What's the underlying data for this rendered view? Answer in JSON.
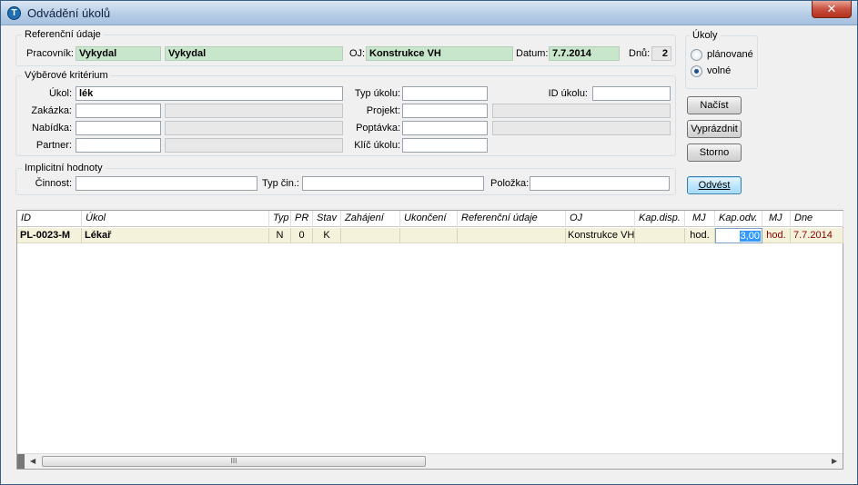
{
  "window": {
    "title": "Odvádění úkolů",
    "close_label": "✕",
    "app_icon_glyph": "T"
  },
  "ref": {
    "legend": "Referenční údaje",
    "pracovnik_label": "Pracovník:",
    "pracovnik_code": "Vykydal",
    "pracovnik_name": "Vykydal",
    "oj_label": "OJ:",
    "oj_value": "Konstrukce VH",
    "datum_label": "Datum:",
    "datum_value": "7.7.2014",
    "dnu_label": "Dnů:",
    "dnu_value": "2"
  },
  "ukoly": {
    "legend": "Úkoly",
    "planovane": "plánované",
    "volne": "volné",
    "selected": "volné"
  },
  "criteria": {
    "legend": "Výběrové kritérium",
    "ukol_label": "Úkol:",
    "ukol_value": "lék",
    "typ_ukolu_label": "Typ úkolu:",
    "id_ukolu_label": "ID úkolu:",
    "zakazka_label": "Zakázka:",
    "projekt_label": "Projekt:",
    "nabidka_label": "Nabídka:",
    "poptavka_label": "Poptávka:",
    "partner_label": "Partner:",
    "klic_ukolu_label": "Klíč úkolu:"
  },
  "defaults": {
    "legend": "Implicitní hodnoty",
    "cinnost_label": "Činnost:",
    "typ_cin_label": "Typ čin.:",
    "polozka_label": "Položka:"
  },
  "buttons": {
    "nacist": "Načíst",
    "vyprazdnit": "Vyprázdnit",
    "storno": "Storno",
    "odvest": "Odvést"
  },
  "table": {
    "headers": [
      "ID",
      "Úkol",
      "Typ",
      "PR",
      "Stav",
      "Zahájení",
      "Ukončení",
      "Referenční údaje",
      "OJ",
      "Kap.disp.",
      "MJ",
      "Kap.odv.",
      "MJ",
      "Dne"
    ],
    "rows": [
      {
        "id": "PL-0023-M",
        "ukol": "Lékař",
        "typ": "N",
        "pr": "0",
        "stav": "K",
        "zahajeni": "",
        "ukonceni": "",
        "ref": "",
        "oj": "Konstrukce VH",
        "kap_disp": "",
        "mj1": "hod.",
        "kap_odv": "3,00",
        "mj2": "hod.",
        "dne": "7.7.2014"
      }
    ]
  },
  "scrollbar": {
    "grip": "III",
    "left_arrow": "◀",
    "right_arrow": "▶"
  }
}
